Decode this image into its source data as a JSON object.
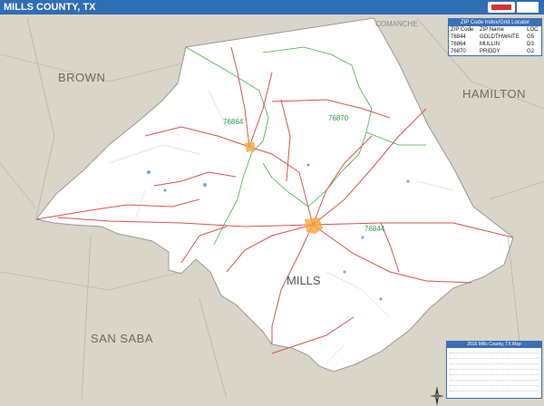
{
  "title": "MILLS COUNTY, TX",
  "map_labels": {
    "brown": "BROWN",
    "hamilton": "HAMILTON",
    "comanche": "COMANCHE",
    "san_saba": "SAN SABA",
    "mills": "MILLS"
  },
  "zip_labels": [
    "76864",
    "76870",
    "76844"
  ],
  "zip_table": {
    "title": "ZIP Code Index/Grid Locator",
    "headers": [
      "ZIP Code",
      "ZIP Name",
      "LOC"
    ],
    "rows": [
      [
        "76844",
        "GOLDTHWAITE",
        "G5"
      ],
      [
        "76864",
        "MULLIN",
        "D3"
      ],
      [
        "76870",
        "PRIDDY",
        "G2"
      ]
    ]
  },
  "legend": {
    "title": "2016 Mills County, TX Map"
  },
  "colors": {
    "title_bar": "#2f6db5",
    "county_fill": "#ffffff",
    "outside_fill": "#d9d5c8",
    "roads": "#d9534f",
    "zip_boundary": "#3fb24b",
    "water": "#6fa8dc"
  }
}
